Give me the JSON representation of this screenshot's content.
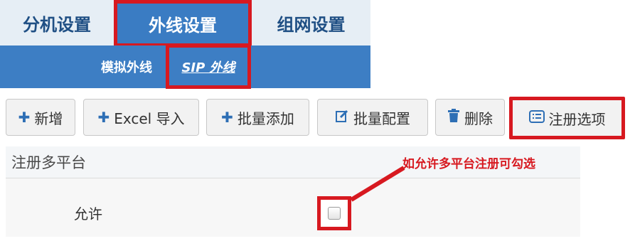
{
  "tabs": {
    "items": [
      {
        "label": "分机设置"
      },
      {
        "label": "外线设置",
        "active": true
      },
      {
        "label": "组网设置"
      }
    ]
  },
  "subtabs": {
    "items": [
      {
        "label": "模拟外线"
      },
      {
        "label": "SIP 外线",
        "active": true
      }
    ]
  },
  "toolbar": {
    "add": {
      "label": "新增",
      "icon": "plus-icon"
    },
    "excel_import": {
      "label": "Excel 导入",
      "icon": "plus-icon"
    },
    "batch_add": {
      "label": "批量添加",
      "icon": "plus-icon"
    },
    "batch_config": {
      "label": "批量配置",
      "icon": "edit-icon"
    },
    "delete": {
      "label": "删除",
      "icon": "trash-icon"
    },
    "register_options": {
      "label": "注册选项",
      "icon": "list-icon"
    }
  },
  "section": {
    "title": "注册多平台",
    "allow_label": "允许",
    "allow_checked": false
  },
  "annotation": {
    "text": "如允许多平台注册可勾选",
    "color": "#d71920"
  },
  "colors": {
    "tab_active_bg": "#3a7cc3",
    "subbar_bg": "#3d7ec4",
    "highlight": "#d71920"
  }
}
